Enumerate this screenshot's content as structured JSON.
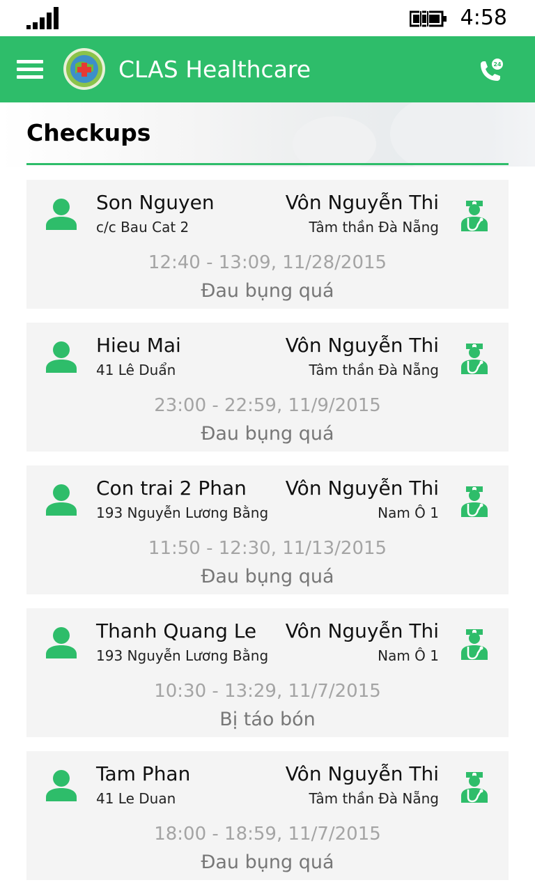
{
  "status_bar": {
    "time": "4:58",
    "signal_icon": "signal-icon",
    "battery_icon": "battery-charging-icon"
  },
  "app_bar": {
    "title": "CLAS Healthcare",
    "menu_icon": "hamburger-menu-icon",
    "logo": "clas-logo",
    "call_icon": "phone-24h-icon",
    "accent": "#2ebd6a"
  },
  "page": {
    "title": "Checkups"
  },
  "checkups": [
    {
      "patient_name": "Son Nguyen",
      "patient_address": "c/c Bau Cat 2",
      "doctor_name": "Vôn Nguyễn Thi",
      "clinic": "Tâm thần Đà Nẵng",
      "time": "12:40 - 13:09, 11/28/2015",
      "symptom": "Đau bụng quá"
    },
    {
      "patient_name": "Hieu Mai",
      "patient_address": "41 Lê Duẩn",
      "doctor_name": "Vôn Nguyễn Thi",
      "clinic": "Tâm thần Đà Nẵng",
      "time": "23:00 - 22:59, 11/9/2015",
      "symptom": "Đau bụng quá"
    },
    {
      "patient_name": "Con trai 2 Phan",
      "patient_address": "193 Nguyễn Lương Bằng",
      "doctor_name": "Vôn Nguyễn Thi",
      "clinic": "Nam Ô 1",
      "time": "11:50 - 12:30, 11/13/2015",
      "symptom": "Đau bụng quá"
    },
    {
      "patient_name": "Thanh Quang Le",
      "patient_address": "193 Nguyễn Lương Bằng",
      "doctor_name": "Vôn Nguyễn Thi",
      "clinic": "Nam Ô 1",
      "time": "10:30 - 13:29, 11/7/2015",
      "symptom": "Bị táo bón"
    },
    {
      "patient_name": "Tam Phan",
      "patient_address": "41 Le Duan",
      "doctor_name": "Vôn Nguyễn Thi",
      "clinic": "Tâm thần Đà Nẵng",
      "time": "18:00 - 18:59, 11/7/2015",
      "symptom": "Đau bụng quá"
    }
  ]
}
